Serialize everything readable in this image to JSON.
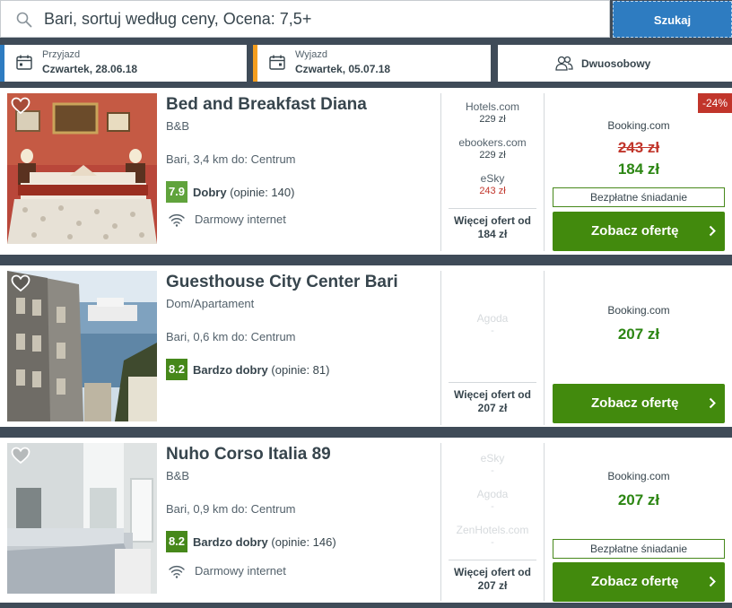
{
  "search": {
    "query": "Bari, sortuj według ceny, Ocena: 7,5+",
    "button_label": "Szukaj"
  },
  "filters": {
    "checkin": {
      "label": "Przyjazd",
      "value": "Czwartek, 28.06.18"
    },
    "checkout": {
      "label": "Wyjazd",
      "value": "Czwartek, 05.07.18"
    },
    "room": "Dwuosobowy"
  },
  "hotels": [
    {
      "name": "Bed and Breakfast Diana",
      "type": "B&B",
      "distance": "Bari, 3,4 km do: Centrum",
      "score": "7.9",
      "rating_word": "Dobry",
      "rating_count": "(opinie: 140)",
      "amenity": "Darmowy internet",
      "offers": [
        {
          "name": "Hotels.com",
          "price": "229 zł"
        },
        {
          "name": "ebookers.com",
          "price": "229 zł"
        },
        {
          "name": "eSky",
          "price": "243 zł"
        }
      ],
      "more_offers": "Więcej ofert od",
      "more_price": "184 zł",
      "discount": "-24%",
      "provider": "Booking.com",
      "old_price": "243 zł",
      "price": "184 zł",
      "perk": "Bezpłatne śniadanie",
      "cta": "Zobacz ofertę"
    },
    {
      "name": "Guesthouse City Center Bari",
      "type": "Dom/Apartament",
      "distance": "Bari, 0,6 km do: Centrum",
      "score": "8.2",
      "rating_word": "Bardzo dobry",
      "rating_count": "(opinie: 81)",
      "offers": [
        {
          "name": "Agoda",
          "price": "-"
        }
      ],
      "more_offers": "Więcej ofert od",
      "more_price": "207 zł",
      "provider": "Booking.com",
      "price": "207 zł",
      "cta": "Zobacz ofertę"
    },
    {
      "name": "Nuho Corso Italia 89",
      "type": "B&B",
      "distance": "Bari, 0,9 km do: Centrum",
      "score": "8.2",
      "rating_word": "Bardzo dobry",
      "rating_count": "(opinie: 146)",
      "amenity": "Darmowy internet",
      "offers": [
        {
          "name": "eSky",
          "price": "-"
        },
        {
          "name": "Agoda",
          "price": "-"
        },
        {
          "name": "ZenHotels.com",
          "price": "-"
        }
      ],
      "more_offers": "Więcej ofert od",
      "more_price": "207 zł",
      "provider": "Booking.com",
      "price": "207 zł",
      "perk": "Bezpłatne śniadanie",
      "cta": "Zobacz ofertę"
    }
  ],
  "colors": {
    "primary_blue": "#2e7cc1",
    "checkout_orange": "#f59e1e",
    "cta_green": "#428a0d",
    "price_green": "#2c8613",
    "discount_red": "#c1352b"
  }
}
